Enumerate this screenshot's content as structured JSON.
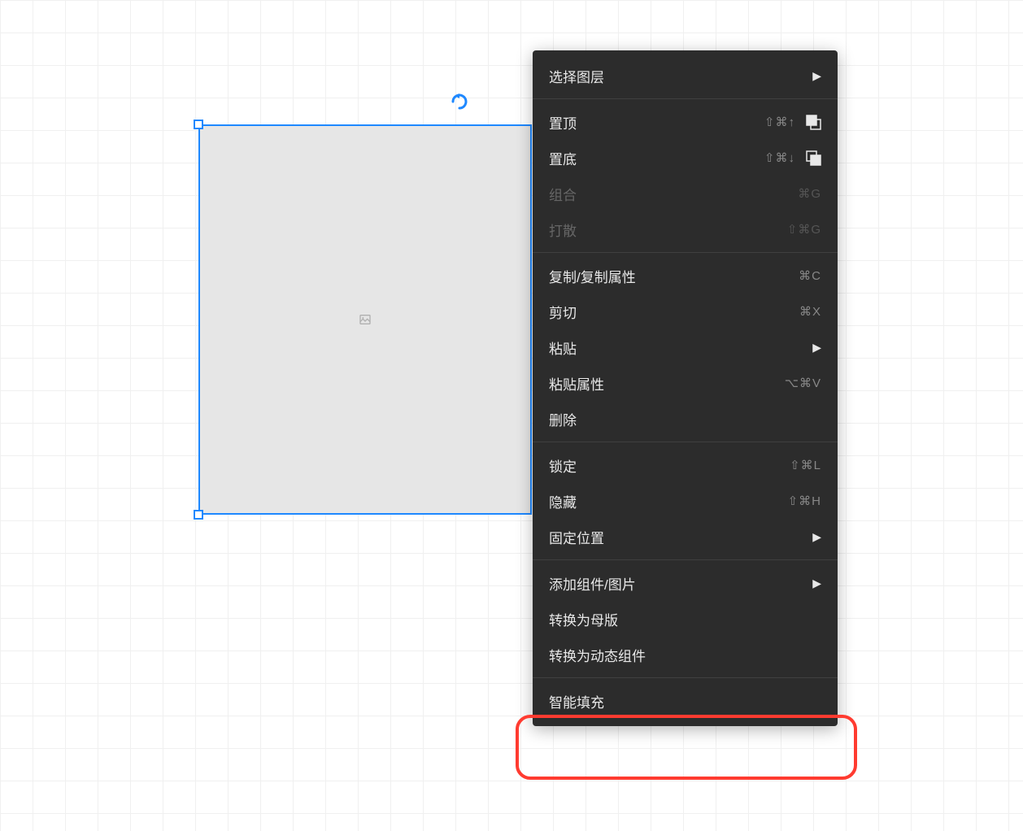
{
  "canvas": {
    "selected_shape_type": "image-placeholder"
  },
  "context_menu": {
    "sections": [
      {
        "items": [
          {
            "id": "select-layer",
            "label": "选择图层",
            "shortcut": "",
            "submenu": true,
            "disabled": false,
            "icon": null
          }
        ]
      },
      {
        "items": [
          {
            "id": "bring-to-front",
            "label": "置顶",
            "shortcut": "⇧⌘↑",
            "submenu": false,
            "disabled": false,
            "icon": "front"
          },
          {
            "id": "send-to-back",
            "label": "置底",
            "shortcut": "⇧⌘↓",
            "submenu": false,
            "disabled": false,
            "icon": "back"
          },
          {
            "id": "group",
            "label": "组合",
            "shortcut": "⌘G",
            "submenu": false,
            "disabled": true,
            "icon": null
          },
          {
            "id": "ungroup",
            "label": "打散",
            "shortcut": "⇧⌘G",
            "submenu": false,
            "disabled": true,
            "icon": null
          }
        ]
      },
      {
        "items": [
          {
            "id": "copy",
            "label": "复制/复制属性",
            "shortcut": "⌘C",
            "submenu": false,
            "disabled": false,
            "icon": null
          },
          {
            "id": "cut",
            "label": "剪切",
            "shortcut": "⌘X",
            "submenu": false,
            "disabled": false,
            "icon": null
          },
          {
            "id": "paste",
            "label": "粘贴",
            "shortcut": "",
            "submenu": true,
            "disabled": false,
            "icon": null
          },
          {
            "id": "paste-properties",
            "label": "粘贴属性",
            "shortcut": "⌥⌘V",
            "submenu": false,
            "disabled": false,
            "icon": null
          },
          {
            "id": "delete",
            "label": "删除",
            "shortcut": "",
            "submenu": false,
            "disabled": false,
            "icon": null
          }
        ]
      },
      {
        "items": [
          {
            "id": "lock",
            "label": "锁定",
            "shortcut": "⇧⌘L",
            "submenu": false,
            "disabled": false,
            "icon": null
          },
          {
            "id": "hide",
            "label": "隐藏",
            "shortcut": "⇧⌘H",
            "submenu": false,
            "disabled": false,
            "icon": null
          },
          {
            "id": "fix-position",
            "label": "固定位置",
            "shortcut": "",
            "submenu": true,
            "disabled": false,
            "icon": null
          }
        ]
      },
      {
        "items": [
          {
            "id": "add-component",
            "label": "添加组件/图片",
            "shortcut": "",
            "submenu": true,
            "disabled": false,
            "icon": null
          },
          {
            "id": "convert-to-master",
            "label": "转换为母版",
            "shortcut": "",
            "submenu": false,
            "disabled": false,
            "icon": null
          },
          {
            "id": "convert-to-dynamic",
            "label": "转换为动态组件",
            "shortcut": "",
            "submenu": false,
            "disabled": false,
            "icon": null
          }
        ]
      },
      {
        "items": [
          {
            "id": "smart-fill",
            "label": "智能填充",
            "shortcut": "",
            "submenu": false,
            "disabled": false,
            "icon": null
          }
        ]
      }
    ]
  }
}
